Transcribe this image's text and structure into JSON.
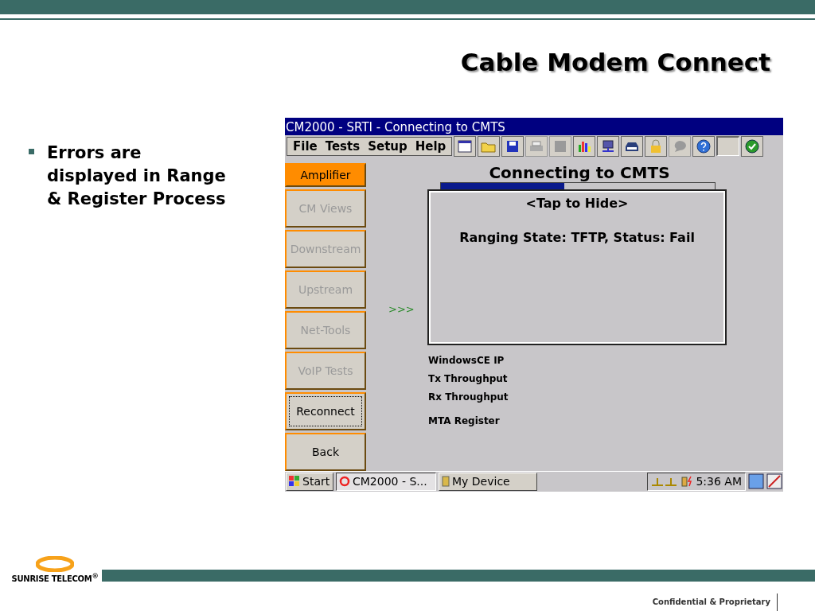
{
  "slide": {
    "title": "Cable Modem Connect",
    "bullets": [
      "Errors are displayed in Range & Register Process"
    ],
    "footer": {
      "logo_text": "SUNRISE TELECOM",
      "logo_mark": "®",
      "note": "Confidential & Proprietary"
    }
  },
  "window": {
    "title": "CM2000 - SRTI - Connecting to CMTS",
    "menu": [
      "File",
      "Tests",
      "Setup",
      "Help"
    ],
    "toolbar": [
      {
        "kind": "calendar"
      },
      {
        "kind": "folder"
      },
      {
        "kind": "save"
      },
      {
        "kind": "printer"
      },
      {
        "kind": "blank"
      },
      {
        "kind": "chart"
      },
      {
        "kind": "computer"
      },
      {
        "kind": "modem"
      },
      {
        "kind": "lock"
      },
      {
        "kind": "bubble"
      },
      {
        "kind": "help"
      },
      {
        "kind": "field"
      },
      {
        "kind": "check"
      }
    ],
    "sidebar": [
      {
        "label": "Amplifier",
        "selected": true,
        "disabled": false,
        "focused": false
      },
      {
        "label": "CM Views",
        "selected": false,
        "disabled": true,
        "focused": false
      },
      {
        "label": "Downstream",
        "selected": false,
        "disabled": true,
        "focused": false
      },
      {
        "label": "Upstream",
        "selected": false,
        "disabled": true,
        "focused": false
      },
      {
        "label": "Net-Tools",
        "selected": false,
        "disabled": true,
        "focused": false
      },
      {
        "label": "VoIP Tests",
        "selected": false,
        "disabled": true,
        "focused": false
      },
      {
        "label": "Reconnect",
        "selected": false,
        "disabled": false,
        "focused": true
      },
      {
        "label": "Back",
        "selected": false,
        "disabled": false,
        "focused": false
      }
    ],
    "heading": "Connecting to CMTS",
    "progress": {
      "level": 0.45
    },
    "arrow": ">>>",
    "steps": [
      "WindowsCE IP",
      "Tx Throughput",
      "Rx Throughput",
      "MTA Register"
    ],
    "popup": {
      "hint": "<Tap to Hide>",
      "message": "Ranging State: TFTP, Status: Fail"
    },
    "taskbar": {
      "start": "Start",
      "tasks": [
        {
          "label": "CM2000 - S...",
          "selected": true
        },
        {
          "label": "My Device",
          "selected": false
        }
      ],
      "time": "5:36 AM"
    }
  }
}
